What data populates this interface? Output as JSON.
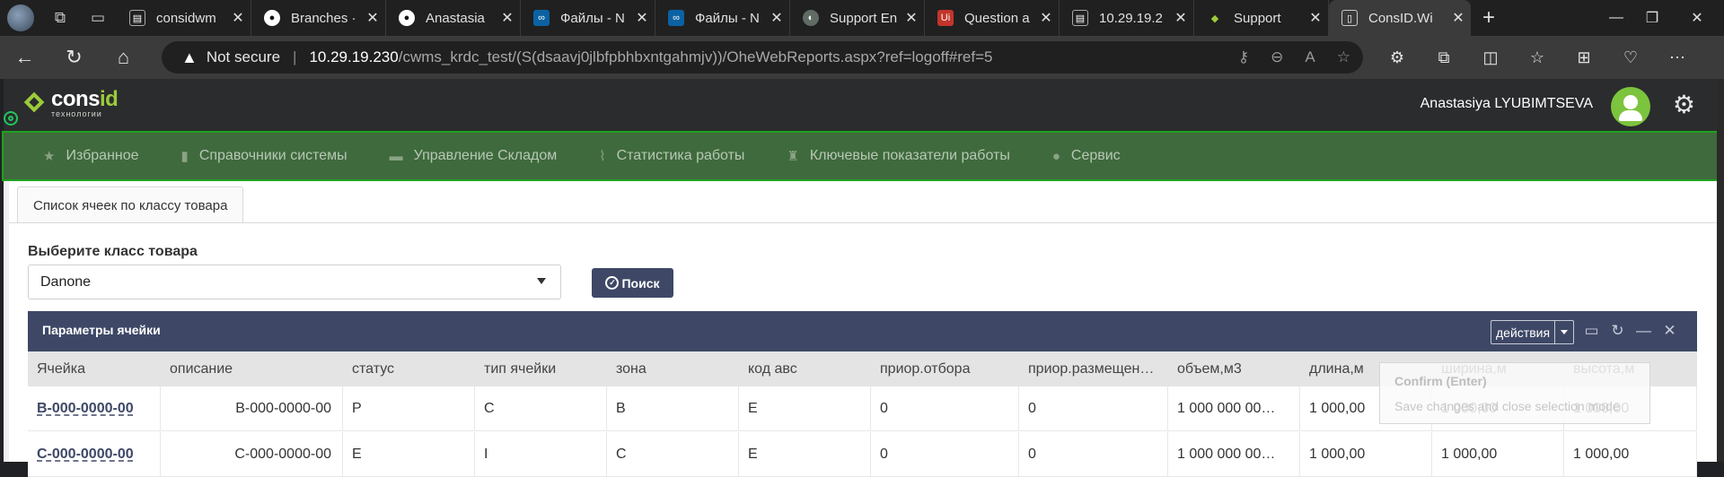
{
  "browser": {
    "tabs": [
      {
        "label": "considwm",
        "icon": "page-icon",
        "color": "#555555"
      },
      {
        "label": "Branches ·",
        "icon": "github-icon",
        "color": "#555555"
      },
      {
        "label": "Anastasia",
        "icon": "github-icon",
        "color": "#555555"
      },
      {
        "label": "Файлы - N",
        "icon": "nextcloud-icon",
        "color": "#0b62a3"
      },
      {
        "label": "Файлы - N",
        "icon": "nextcloud-icon",
        "color": "#0b62a3"
      },
      {
        "label": "Support En",
        "icon": "support-icon",
        "color": "#5f6b63"
      },
      {
        "label": "Question a",
        "icon": "uipath-icon",
        "color": "#c2352a"
      },
      {
        "label": "10.29.19.2",
        "icon": "page-icon",
        "color": "#555555"
      },
      {
        "label": "Support",
        "icon": "consid-icon",
        "color": "#3a7a2e"
      },
      {
        "label": "ConsID.Wi",
        "icon": "document-icon",
        "color": "#777777"
      }
    ],
    "address": {
      "warning": "Not secure",
      "separator": "|",
      "host": "10.29.19.230",
      "path": "/cwms_krdc_test/(S(dsaavj0jlbfpbhbxntgahmjv))/OheWebReports.aspx?ref=logoff#ref=5"
    }
  },
  "app": {
    "logo": {
      "name_main": "cons",
      "name_accent": "id",
      "tagline": "технологии"
    },
    "user_name": "Anastasiya LYUBIMTSEVA",
    "menu": [
      {
        "label": "Избранное",
        "icon": "star-icon"
      },
      {
        "label": "Справочники системы",
        "icon": "book-icon"
      },
      {
        "label": "Управление Складом",
        "icon": "warehouse-icon"
      },
      {
        "label": "Статистика работы",
        "icon": "chart-icon"
      },
      {
        "label": "Ключевые показатели работы",
        "icon": "trophy-icon"
      },
      {
        "label": "Сервис",
        "icon": "info-icon"
      }
    ],
    "page_tab": "Список ячеек по классу товара",
    "form": {
      "label": "Выберите класс товара",
      "selected": "Danone",
      "search_label": "Поиск"
    },
    "panel": {
      "title": "Параметры ячейки",
      "actions_label": "действия"
    },
    "grid": {
      "columns": [
        "Ячейка",
        "описание",
        "статус",
        "тип ячейки",
        "зона",
        "код авс",
        "приор.отбора",
        "приор.размещен…",
        "объем,м3",
        "длина,м",
        "ширина,м",
        "высота,м"
      ],
      "rows": [
        [
          "B-000-0000-00",
          "B-000-0000-00",
          "P",
          "C",
          "B",
          "E",
          "0",
          "0",
          "1 000 000 00…",
          "1 000,00",
          "1 000,00",
          "1 000,00"
        ],
        [
          "C-000-0000-00",
          "C-000-0000-00",
          "E",
          "I",
          "C",
          "E",
          "0",
          "0",
          "1 000 000 00…",
          "1 000,00",
          "1 000,00",
          "1 000,00"
        ]
      ]
    },
    "confirm": {
      "title": "Confirm (Enter)",
      "subtitle": "Save changes and close selection mode"
    }
  }
}
